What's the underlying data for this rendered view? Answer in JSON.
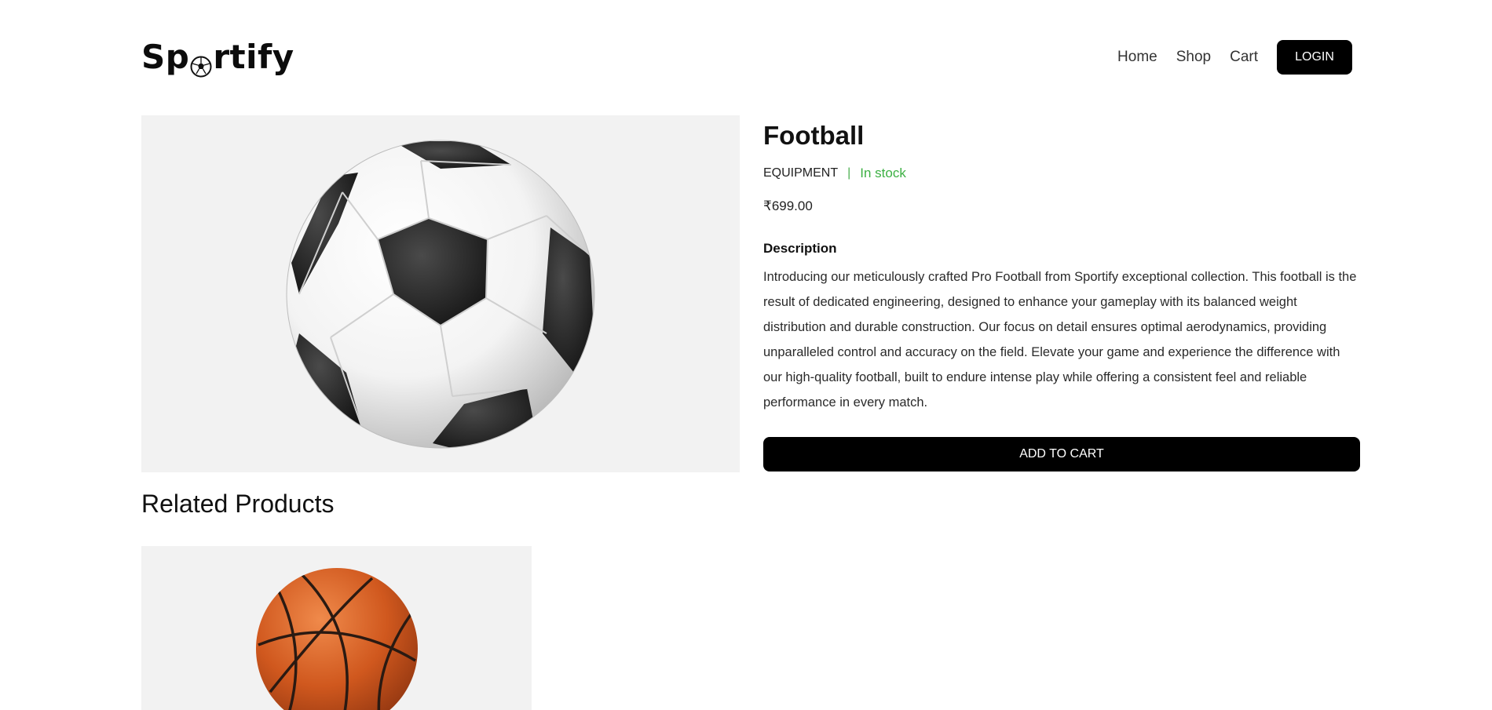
{
  "header": {
    "logo_prefix": "Sp",
    "logo_suffix": "rtify",
    "nav": [
      {
        "label": "Home"
      },
      {
        "label": "Shop"
      },
      {
        "label": "Cart"
      }
    ],
    "login_label": "LOGIN"
  },
  "product": {
    "name": "Football",
    "category": "EQUIPMENT",
    "separator": "|",
    "stock_status": "In stock",
    "price": "₹699.00",
    "description_heading": "Description",
    "description": "Introducing our meticulously crafted Pro Football from Sportify exceptional collection. This football is the result of dedicated engineering, designed to enhance your gameplay with its balanced weight distribution and durable construction. Our focus on detail ensures optimal aerodynamics, providing unparalleled control and accuracy on the field. Elevate your game and experience the difference with our high-quality football, built to endure intense play while offering a consistent feel and reliable performance in every match.",
    "add_to_cart_label": "ADD TO CART",
    "image_icon": "soccer-ball-image"
  },
  "related": {
    "heading": "Related Products",
    "items": [
      {
        "image_icon": "basketball-image"
      }
    ]
  },
  "colors": {
    "accent": "#000000",
    "stock_green": "#3cb043",
    "panel_bg": "#f2f2f2"
  }
}
